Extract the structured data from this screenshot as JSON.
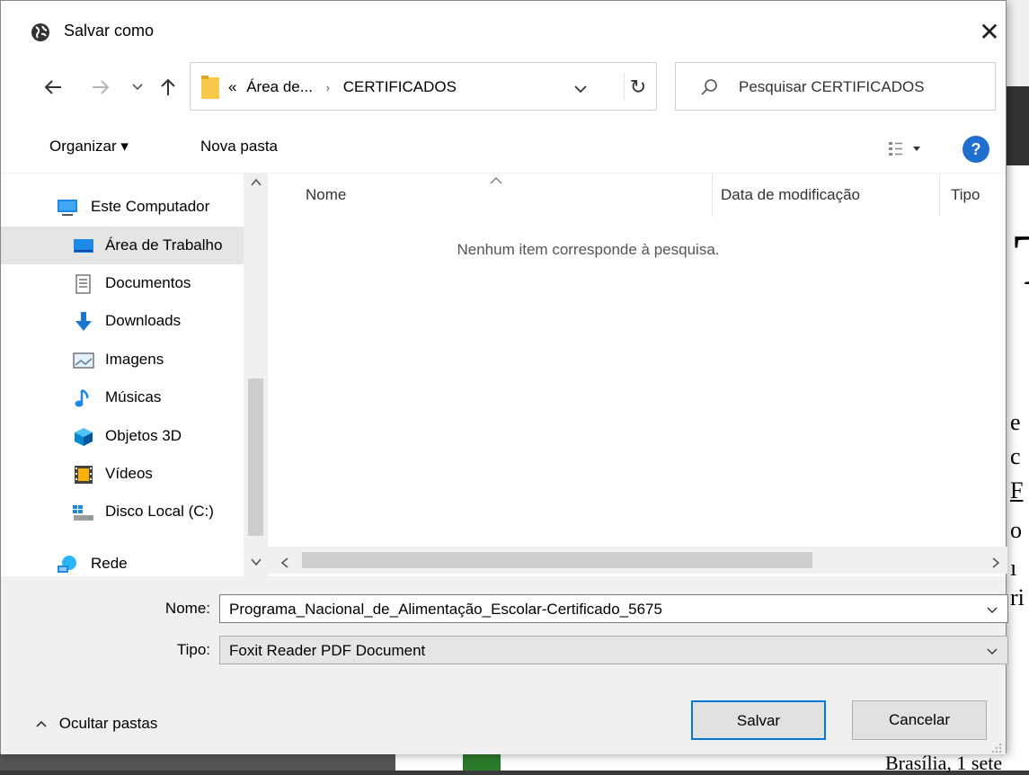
{
  "dialog": {
    "title": "Salvar como",
    "close_label": "✕"
  },
  "address": {
    "overflow": "«",
    "crumb_1": "Área de...",
    "separator": "›",
    "crumb_2": "CERTIFICADOS"
  },
  "search": {
    "placeholder": "Pesquisar CERTIFICADOS"
  },
  "toolbar": {
    "organize_label": "Organizar ▾",
    "new_folder_label": "Nova pasta",
    "help_label": "?"
  },
  "nav_pane": {
    "items": [
      {
        "label": "Este Computador",
        "icon": "computer-icon"
      },
      {
        "label": "Área de Trabalho",
        "icon": "desktop-icon",
        "selected": true
      },
      {
        "label": "Documentos",
        "icon": "documents-icon"
      },
      {
        "label": "Downloads",
        "icon": "downloads-icon"
      },
      {
        "label": "Imagens",
        "icon": "pictures-icon"
      },
      {
        "label": "Músicas",
        "icon": "music-icon"
      },
      {
        "label": "Objetos 3D",
        "icon": "3d-objects-icon"
      },
      {
        "label": "Vídeos",
        "icon": "videos-icon"
      },
      {
        "label": "Disco Local (C:)",
        "icon": "local-disk-icon"
      },
      {
        "label": "Rede",
        "icon": "network-icon"
      }
    ]
  },
  "file_list": {
    "columns": [
      "Nome",
      "Data de modificação",
      "Tipo"
    ],
    "empty_message": "Nenhum item corresponde à pesquisa."
  },
  "footer": {
    "name_label": "Nome:",
    "name_value": "Programa_Nacional_de_Alimentação_Escolar-Certificado_5675",
    "type_label": "Tipo:",
    "type_value": "Foxit Reader PDF Document",
    "hide_folders_label": "Ocultar pastas",
    "save_label": "Salvar",
    "cancel_label": "Cancelar"
  },
  "colors": {
    "accent": "#0078d7",
    "help": "#1e6fd0",
    "folder": "#f8c848"
  }
}
